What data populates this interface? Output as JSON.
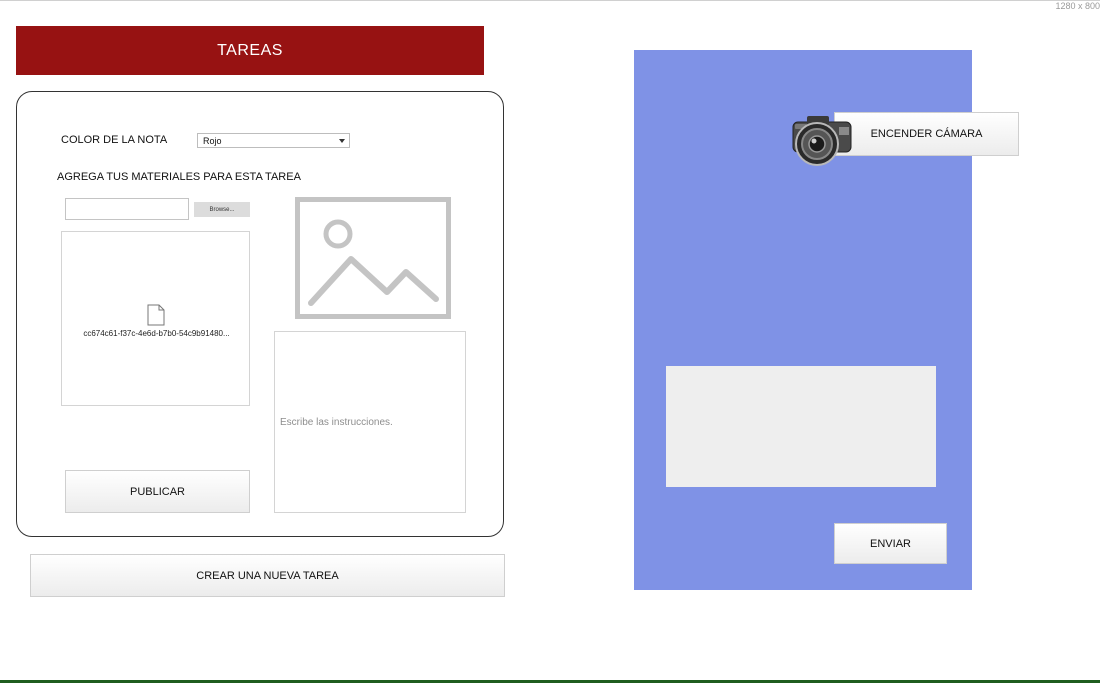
{
  "screen": {
    "size_label": "1280 x 800"
  },
  "header": {
    "title": "TAREAS"
  },
  "form": {
    "color_label": "COLOR DE LA NOTA",
    "color_value": "Rojo",
    "materials_label": "AGREGA TUS MATERIALES PARA ESTA TAREA",
    "browse_label": "Browse...",
    "file_name": "cc674c61-f37c-4e6d-b7b0-54c9b91480...",
    "instructions_placeholder": "Escribe las instrucciones.",
    "publish_label": "PUBLICAR"
  },
  "actions": {
    "new_task_label": "CREAR UNA NUEVA TAREA"
  },
  "camera": {
    "turn_on_label": "ENCENDER CÁMARA",
    "send_label": "ENVIAR"
  },
  "colors": {
    "header_bg": "#971212",
    "camera_panel_bg": "#7f92e6",
    "preview_bg": "#eeeeee",
    "image_placeholder": "#c4c4c4"
  },
  "icons": [
    "file-icon",
    "image-placeholder-icon",
    "camera-icon",
    "dropdown-arrow-icon"
  ]
}
